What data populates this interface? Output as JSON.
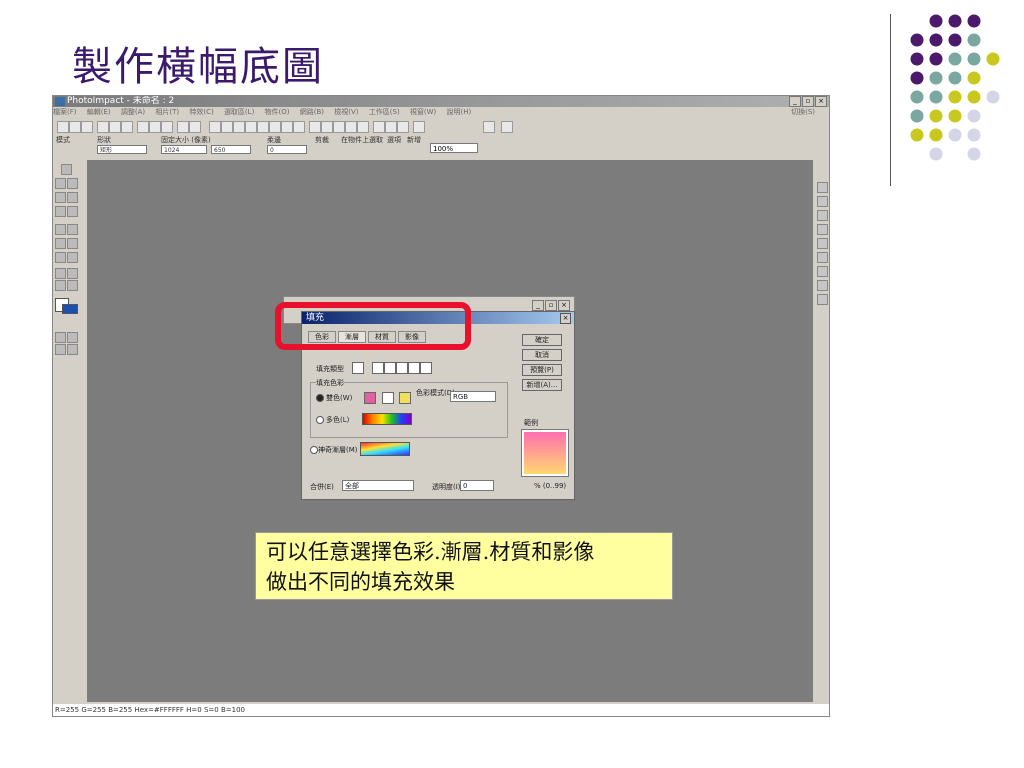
{
  "slide": {
    "title": "製作橫幅底圖",
    "callout_line1": "可以任意選擇色彩.漸層.材質和影像",
    "callout_line2": "做出不同的填充效果"
  },
  "colors": {
    "title": "#3b1a6e",
    "highlight": "#e8102a",
    "callout_bg": "#ffffa0",
    "dot_purple": "#4b1a6b",
    "dot_teal": "#7ba7a1",
    "dot_yellow": "#c8c81e",
    "dot_lavender": "#d5d5e8"
  },
  "app": {
    "title": "PhotoImpact - 未命名 : 2",
    "menu": [
      "檔案(F)",
      "編輯(E)",
      "調整(A)",
      "相片(T)",
      "特效(C)",
      "選取區(L)",
      "物件(O)",
      "網路(B)",
      "檢視(V)",
      "工作區(S)",
      "視窗(W)",
      "說明(H)"
    ],
    "menu_right": "切換(S)",
    "zoom": "100%",
    "toolbar2": {
      "mode_label": "模式",
      "shape_label": "形狀",
      "shape_value": "矩形",
      "size_label": "固定大小 (像素)",
      "width": "1024",
      "height": "650",
      "fuzz_label": "柔邊",
      "fuzz_value": "0",
      "slices_label": "剪裁",
      "object_label": "在物件上選取",
      "option_label": "選項",
      "add_label": "新增"
    },
    "window_buttons": [
      "_",
      "▫",
      "×"
    ],
    "statusbar": "R=255 G=255 B=255  Hex=#FFFFFF  H=0 S=0 B=100"
  },
  "fill_dialog": {
    "title": "填充",
    "tabs": [
      "色彩",
      "漸層",
      "材質",
      "影像"
    ],
    "active_tab": "漸層",
    "buttons": [
      "確定",
      "取消",
      "預覽(P)",
      "新增(A)..."
    ],
    "fill_type_label": "填充類型",
    "fill_color_group": "填充色彩",
    "two_color_label": "雙色(W)",
    "color_mode_label": "色彩模式(D):",
    "color_mode_value": "RGB",
    "multi_color_label": "多色(L)",
    "magic_label": "神奇漸層(M)",
    "sample_label": "範例",
    "merge_label": "合併(E)",
    "merge_value": "全部",
    "transparency_label": "透明度(I)",
    "transparency_value": "0",
    "transparency_range": "% (0..99)"
  }
}
